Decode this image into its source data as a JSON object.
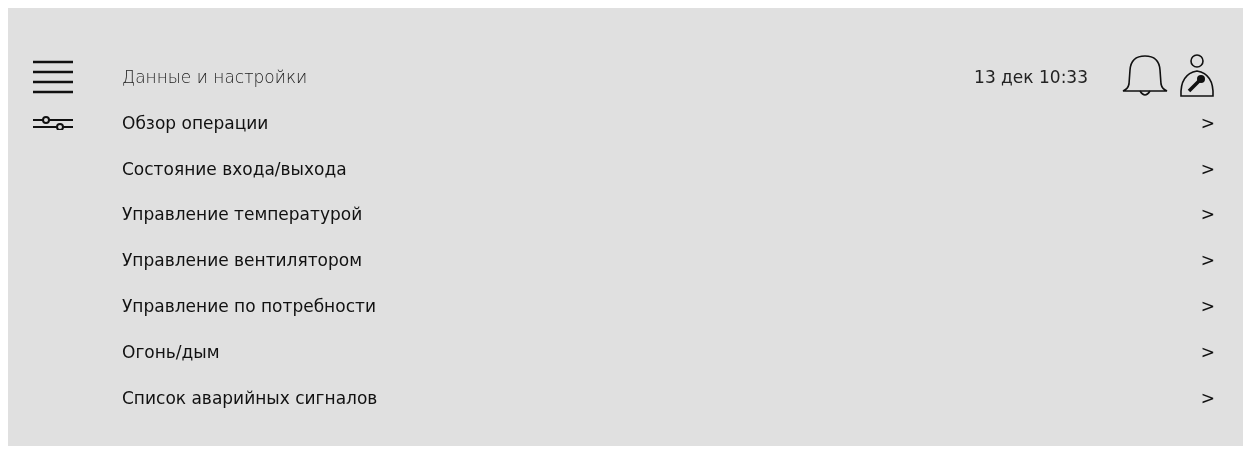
{
  "header": {
    "title": "Данные и настройки",
    "datetime": "13 дек 10:33"
  },
  "menu_items": [
    {
      "label": "Обзор операции",
      "chevron": ">"
    },
    {
      "label": "Состояние входа/выхода",
      "chevron": ">"
    },
    {
      "label": "Управление температурой",
      "chevron": ">"
    },
    {
      "label": "Управление вентилятором",
      "chevron": ">"
    },
    {
      "label": "Управление по потребности",
      "chevron": ">"
    },
    {
      "label": "Огонь/дым",
      "chevron": ">"
    },
    {
      "label": "Список аварийных сигналов",
      "chevron": ">"
    }
  ]
}
